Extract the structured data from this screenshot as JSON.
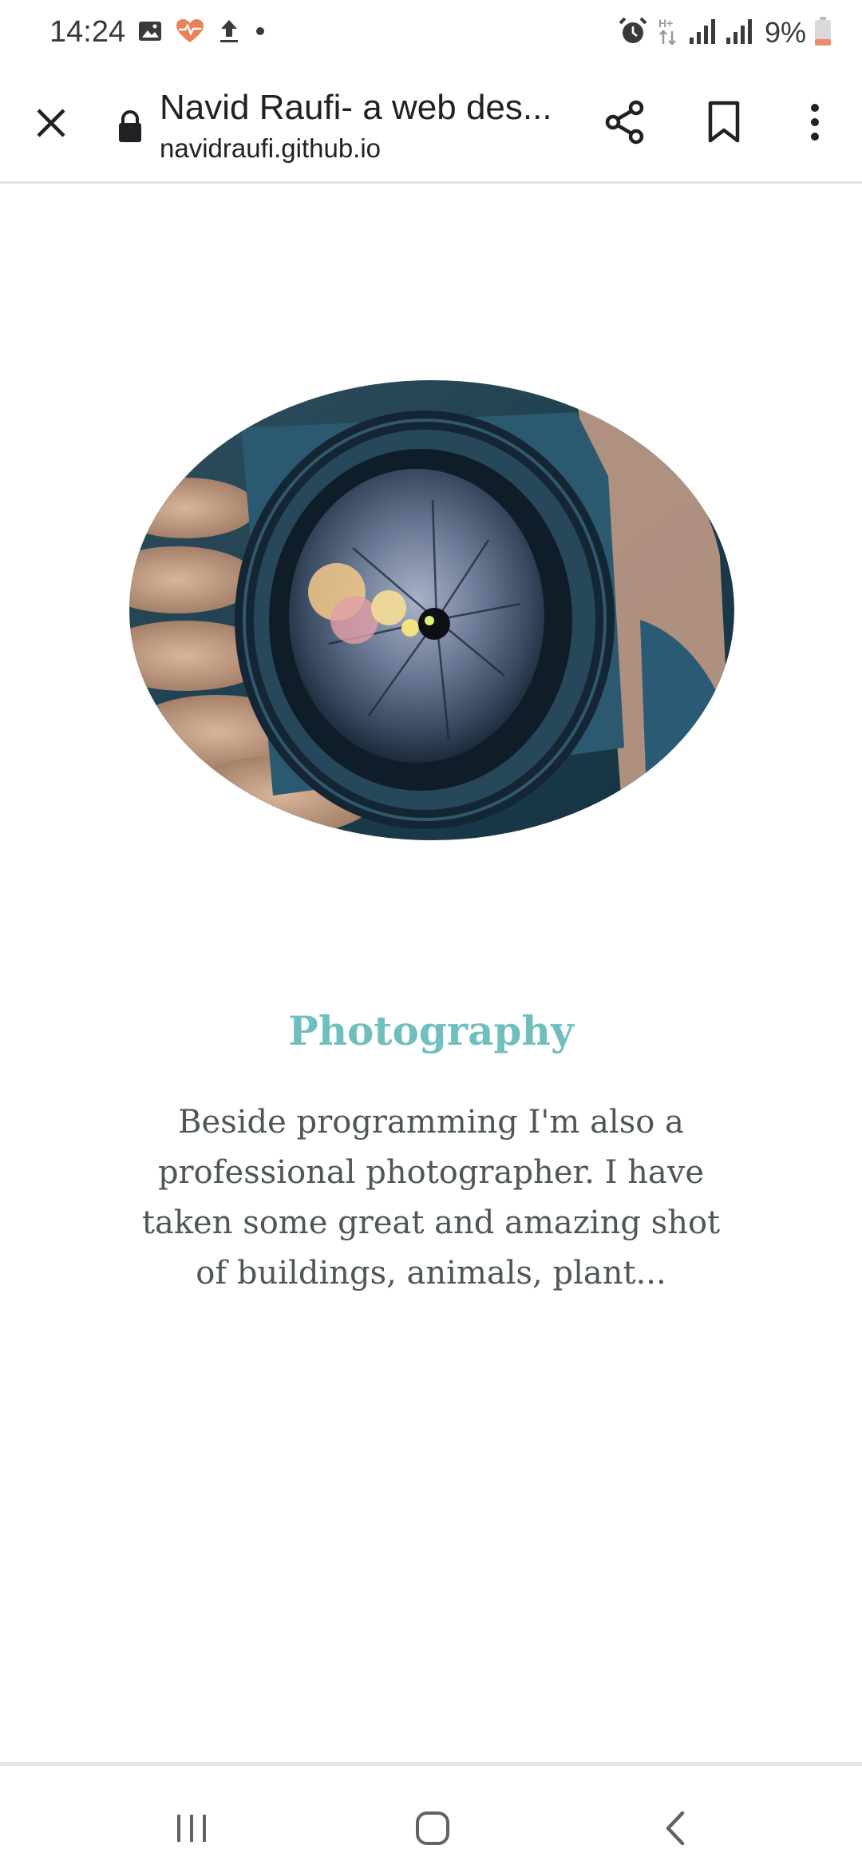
{
  "status_bar": {
    "time": "14:24",
    "battery_percent": "9%",
    "network_type": "H+",
    "left_icons": [
      "image-icon",
      "health-heart-icon",
      "upload-icon",
      "dot-icon"
    ],
    "right_icons": [
      "alarm-icon",
      "data-arrows-icon",
      "signal-icon",
      "signal-icon",
      "battery-low-icon"
    ]
  },
  "toolbar": {
    "page_title": "Navid Raufi- a web des...",
    "url": "navidraufi.github.io",
    "icons": [
      "close-icon",
      "lock-icon",
      "share-icon",
      "bookmark-icon",
      "more-vert-icon"
    ]
  },
  "content": {
    "image_subject": "camera lens close-up held in hands",
    "heading": "Photography",
    "body": "Beside programming I'm also a professional photographer. I have taken some great and amazing shot of buildings, animals, plant..."
  },
  "nav": {
    "icons": [
      "recent-apps-icon",
      "home-icon",
      "back-icon"
    ]
  },
  "colors": {
    "heading": "#6fbfbe",
    "body_text": "#4f5656",
    "battery_low": "#f08a6e",
    "health_heart": "#e9825a"
  }
}
